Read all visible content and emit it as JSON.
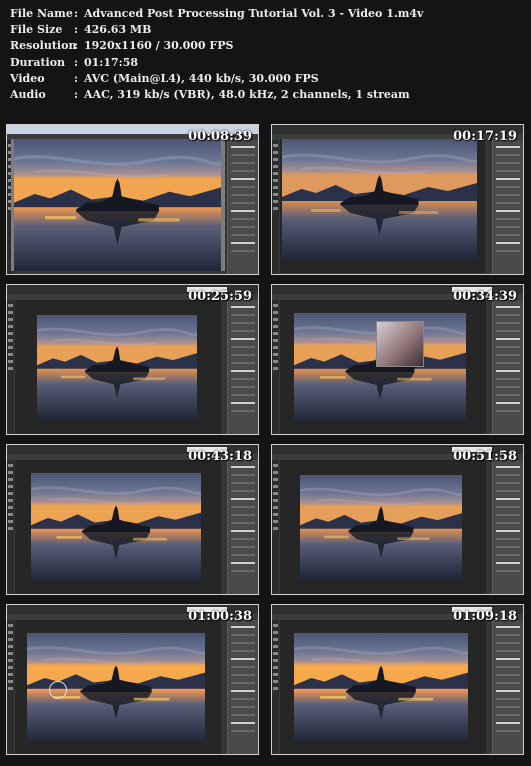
{
  "info": {
    "rows": [
      {
        "key": "File Name",
        "value": "Advanced Post Processing Tutorial Vol. 3 - Video 1.m4v"
      },
      {
        "key": "File Size",
        "value": "426.63 MB"
      },
      {
        "key": "Resolution",
        "value": "1920x1160 / 30.000 FPS"
      },
      {
        "key": "Duration",
        "value": "01:17:58"
      },
      {
        "key": "Video",
        "value": "AVC (Main@L4), 440 kb/s, 30.000 FPS"
      },
      {
        "key": "Audio",
        "value": "AAC, 319 kb/s (VBR), 48.0 kHz, 2 channels, 1 stream"
      }
    ],
    "separator": ":"
  },
  "thumbnails": [
    {
      "timestamp": "00:08:39"
    },
    {
      "timestamp": "00:17:19"
    },
    {
      "timestamp": "00:25:59"
    },
    {
      "timestamp": "00:34:39"
    },
    {
      "timestamp": "00:43:18"
    },
    {
      "timestamp": "00:51:58"
    },
    {
      "timestamp": "01:00:38"
    },
    {
      "timestamp": "01:09:18"
    }
  ],
  "colors": {
    "background": "#141414",
    "ui_dark": "#262626",
    "ui_panel": "#4a4a4a",
    "sky_top": "#5b6787",
    "sky_glow": "#e8a25a",
    "water": "#27314a"
  }
}
